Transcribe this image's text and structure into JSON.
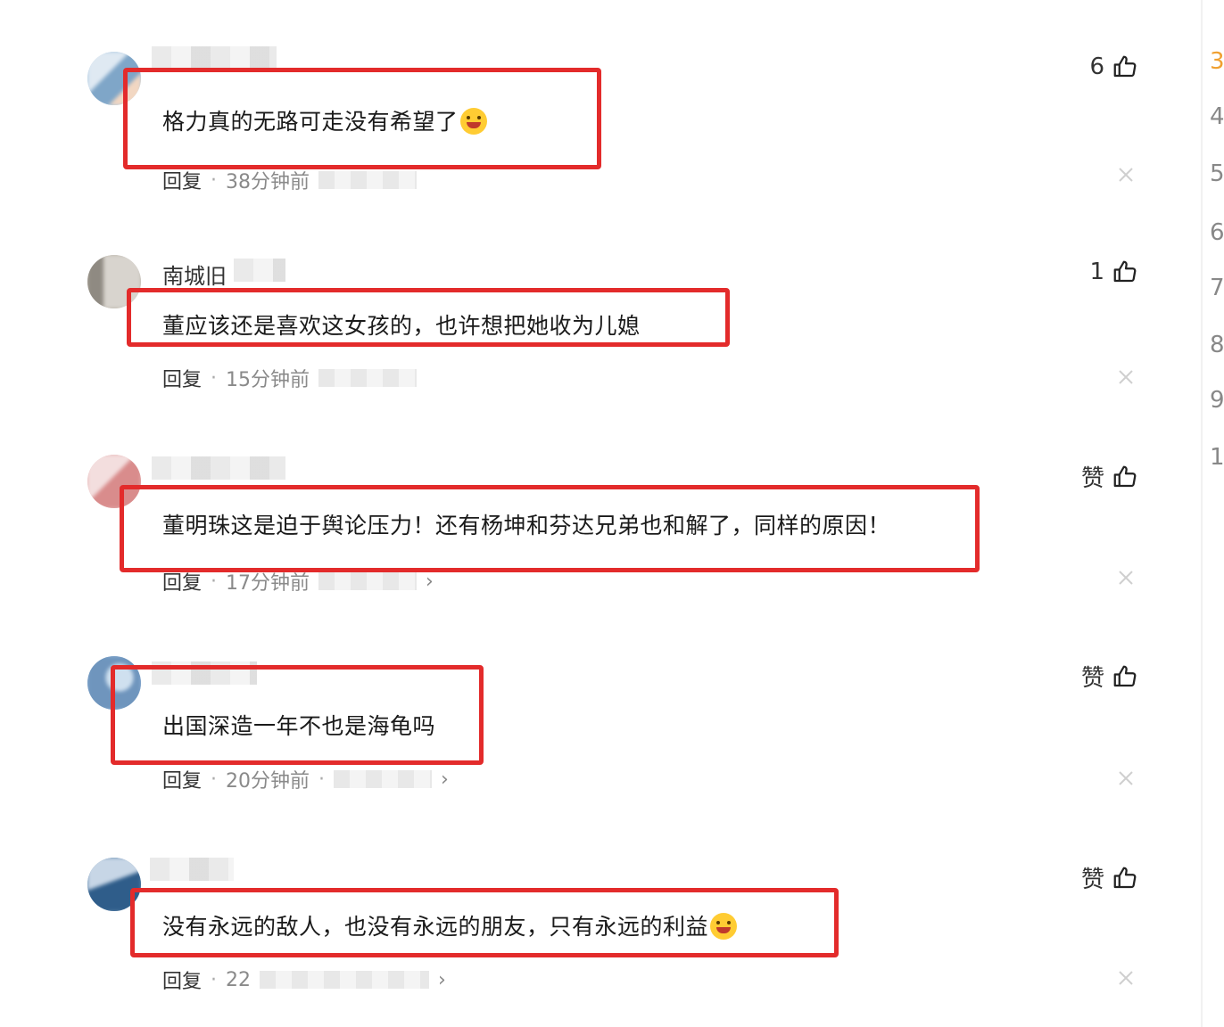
{
  "comments": [
    {
      "username": "",
      "content": "格力真的无路可走没有希望了",
      "reply_label": "回复",
      "time": "38分钟前",
      "likes": "6",
      "avatar_color": "#a9c7e0",
      "emoji": "crying-laughing-emoji"
    },
    {
      "username": "南城旧",
      "content": "董应该还是喜欢这女孩的，也许想把她收为儿媳",
      "reply_label": "回复",
      "time": "15分钟前",
      "likes": "1",
      "avatar_color": "#b9b2a8"
    },
    {
      "username": "",
      "content": "董明珠这是迫于舆论压力！还有杨坤和芬达兄弟也和解了，同样的原因！",
      "reply_label": "回复",
      "time": "17分钟前",
      "likes": "赞",
      "avatar_color": "#e7b3b3"
    },
    {
      "username": "",
      "content": "出国深造一年不也是海龟吗",
      "reply_label": "回复",
      "time": "20分钟前",
      "likes": "赞",
      "avatar_color": "#8fb2d6"
    },
    {
      "username": "",
      "content": "没有永远的敌人，也没有永远的朋友，只有永远的利益",
      "reply_label": "回复",
      "time": "22",
      "likes": "赞",
      "avatar_color": "#5f86ad",
      "emoji": "grinning-emoji"
    }
  ],
  "edge_numbers": [
    "3",
    "4",
    "5",
    "6",
    "7",
    "8",
    "9",
    "1"
  ],
  "colors": {
    "highlight_box": "#e32b2b",
    "meta_text": "#8a8a8a",
    "accent_edge": "#f0a030"
  }
}
